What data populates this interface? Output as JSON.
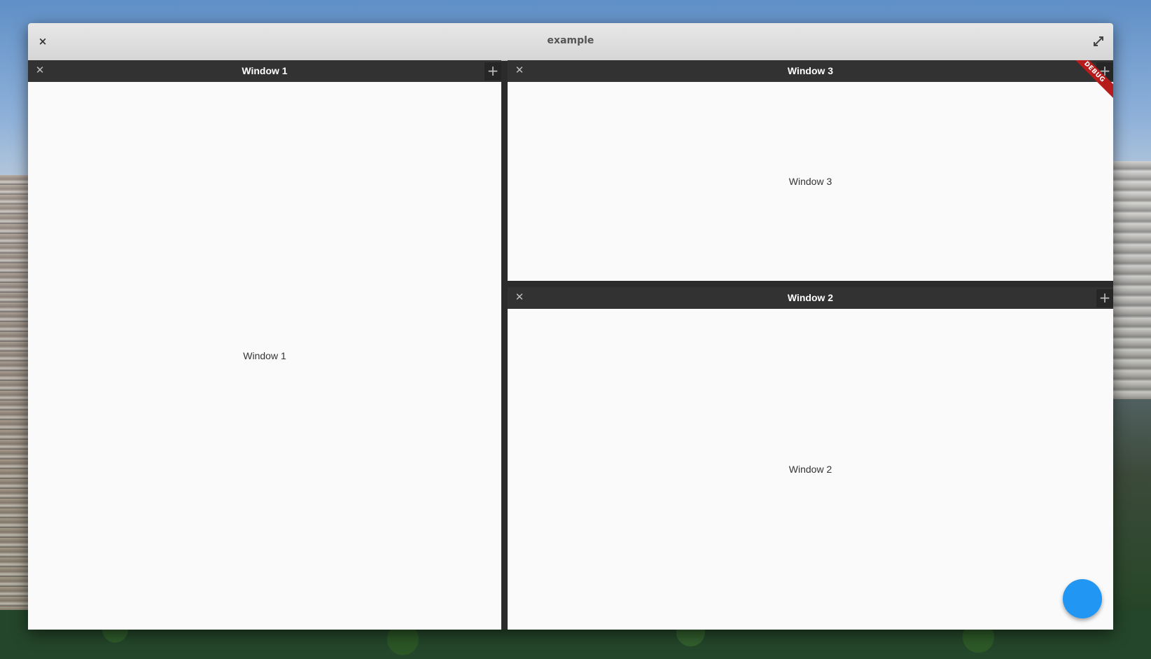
{
  "app": {
    "title": "example",
    "close_label": "×"
  },
  "panes": {
    "window1": {
      "title": "Window 1",
      "content": "Window 1",
      "close_label": "✕",
      "add_label": "+"
    },
    "window3": {
      "title": "Window 3",
      "content": "Window 3",
      "close_label": "✕",
      "add_label": "+"
    },
    "window2": {
      "title": "Window 2",
      "content": "Window 2",
      "close_label": "✕",
      "add_label": "+"
    }
  },
  "debug_banner": "DEBUG",
  "colors": {
    "accent": "#2196f3",
    "debug": "#b71c1c",
    "pane_header": "#323232",
    "pane_body": "#fafafa"
  },
  "icons": {
    "app_close": "close-icon",
    "app_maximize": "maximize-icon",
    "pane_close": "close-icon",
    "pane_add": "plus-icon"
  }
}
